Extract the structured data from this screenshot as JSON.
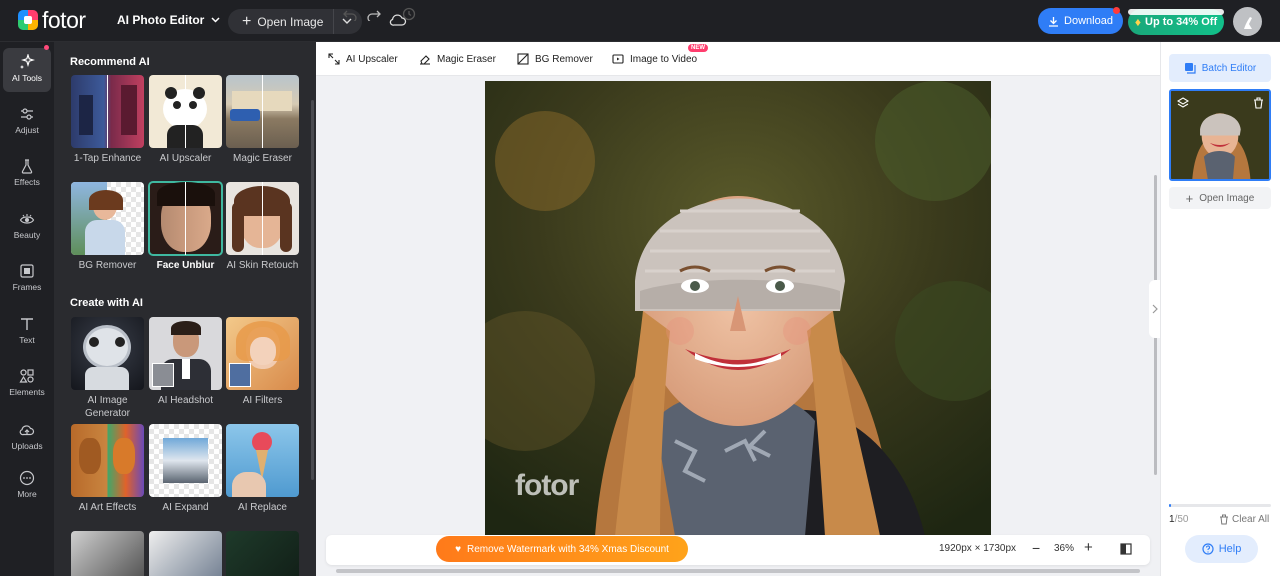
{
  "app": {
    "logo_text": "fotor",
    "tool_select": "AI Photo Editor"
  },
  "topbar": {
    "open_image": "Open Image",
    "download": "Download",
    "promo": "Up to 34% Off"
  },
  "leftnav": [
    {
      "label": "AI Tools"
    },
    {
      "label": "Adjust"
    },
    {
      "label": "Effects"
    },
    {
      "label": "Beauty"
    },
    {
      "label": "Frames"
    },
    {
      "label": "Text"
    },
    {
      "label": "Elements"
    },
    {
      "label": "Uploads"
    },
    {
      "label": "More"
    }
  ],
  "panel": {
    "section1": "Recommend AI",
    "section2": "Create with AI",
    "recommend": [
      {
        "label": "1-Tap Enhance"
      },
      {
        "label": "AI Upscaler"
      },
      {
        "label": "Magic Eraser"
      },
      {
        "label": "BG Remover"
      },
      {
        "label": "Face Unblur"
      },
      {
        "label": "AI Skin Retouch"
      }
    ],
    "create": [
      {
        "label": "AI Image Generator"
      },
      {
        "label": "AI Headshot"
      },
      {
        "label": "AI Filters"
      },
      {
        "label": "AI Art Effects"
      },
      {
        "label": "AI Expand"
      },
      {
        "label": "AI Replace"
      }
    ]
  },
  "toolbar": {
    "upscaler": "AI Upscaler",
    "eraser": "Magic Eraser",
    "bg": "BG Remover",
    "img2video": "Image to Video",
    "new_badge": "NEW"
  },
  "canvas": {
    "watermark": "fotor"
  },
  "bottombar": {
    "promo": "Remove Watermark with 34% Xmas Discount",
    "dimensions": "1920px × 1730px",
    "zoom": "36%"
  },
  "rightpanel": {
    "batch": "Batch Editor",
    "open_image": "Open Image",
    "count": "1",
    "count_total": "/50",
    "progress": 0.02,
    "clear": "Clear All",
    "help": "Help"
  },
  "colors": {
    "accent": "#2f7df6",
    "dark_bg": "#1f2024",
    "panel_bg": "#2a2b2f",
    "promo_orange": "#ff8a1a",
    "pro_green": "#12c08a"
  }
}
